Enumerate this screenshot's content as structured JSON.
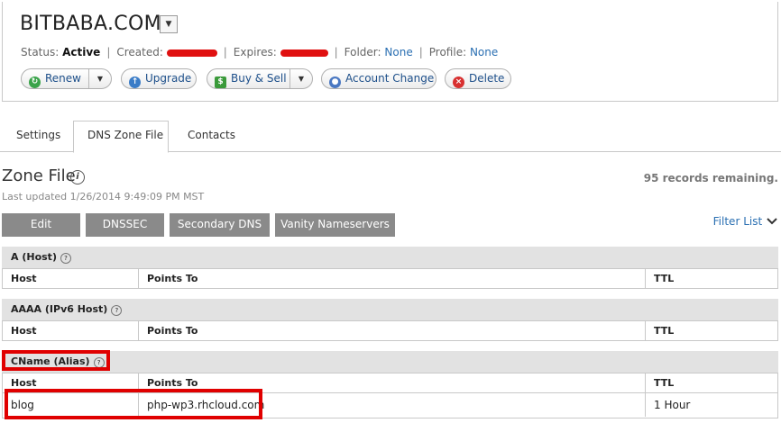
{
  "domain": {
    "name": "BITBABA.COM",
    "menu_glyph": "▼"
  },
  "status_line": {
    "status_label": "Status:",
    "status_value": "Active",
    "created_label": "Created:",
    "expires_label": "Expires:",
    "folder_label": "Folder:",
    "folder_value": "None",
    "profile_label": "Profile:",
    "profile_value": "None",
    "separator": "|"
  },
  "actions": {
    "renew": "Renew",
    "upgrade": "Upgrade",
    "buy_sell": "Buy & Sell",
    "account_change": "Account Change",
    "delete": "Delete",
    "dropdown_glyph": "▼",
    "icons": {
      "renew": "green-circle-arrow-icon",
      "upgrade": "blue-up-arrow-icon",
      "buy_sell": "dollar-icon",
      "account_change": "person-icon",
      "delete": "red-x-icon"
    },
    "colors": {
      "renew": "#3aa34a",
      "upgrade": "#3a7cc7",
      "buy_sell": "#3a9a3a",
      "account_change": "#4a78c2",
      "delete": "#d83030"
    }
  },
  "tabs": [
    {
      "label": "Settings",
      "active": false
    },
    {
      "label": "DNS Zone File",
      "active": true
    },
    {
      "label": "Contacts",
      "active": false
    }
  ],
  "zone": {
    "title": "Zone File",
    "info_glyph": "i",
    "records_remaining": "95 records remaining.",
    "last_updated": "Last updated 1/26/2014 9:49:09 PM MST",
    "buttons": {
      "edit": "Edit",
      "dnssec": "DNSSEC",
      "secondary_dns": "Secondary DNS",
      "vanity": "Vanity Nameservers"
    },
    "filter_list": "Filter List"
  },
  "sections": [
    {
      "title": "A (Host)",
      "columns": [
        "Host",
        "Points To",
        "TTL"
      ],
      "rows": []
    },
    {
      "title": "AAAA (IPv6 Host)",
      "columns": [
        "Host",
        "Points To",
        "TTL"
      ],
      "rows": []
    },
    {
      "title": "CName (Alias)",
      "columns": [
        "Host",
        "Points To",
        "TTL"
      ],
      "rows": [
        {
          "host": "blog",
          "points_to": "php-wp3.rhcloud.com",
          "ttl": "1 Hour"
        }
      ]
    }
  ],
  "colors": {
    "accent_link": "#2a6fb2",
    "highlight_red": "#e00000",
    "gray_button": "#8a8a8a",
    "section_bg": "#e2e2e2"
  }
}
